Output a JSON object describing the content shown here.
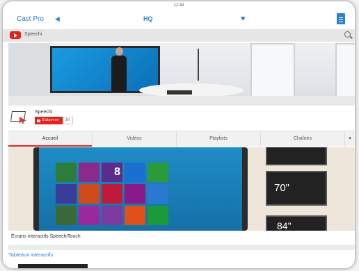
{
  "status": {
    "time": "11:34"
  },
  "navbar": {
    "app_label": "Cast Pro",
    "quality_label": "HQ"
  },
  "youtube": {
    "title": "Speechi"
  },
  "channel": {
    "name": "Speechi",
    "subscribe_label": "S'abonner",
    "subscribers": "1K"
  },
  "tabs": [
    "Accueil",
    "Vidéos",
    "Playlists",
    "Chaînes"
  ],
  "video": {
    "title": "Écrans interactifs SpeechiTouch",
    "tv_sizes": [
      "70\"",
      "84\""
    ]
  },
  "section": {
    "title": "Tableaux interactifs"
  },
  "colors": {
    "accent": "#2a7fd6",
    "youtube_red": "#e62117"
  }
}
